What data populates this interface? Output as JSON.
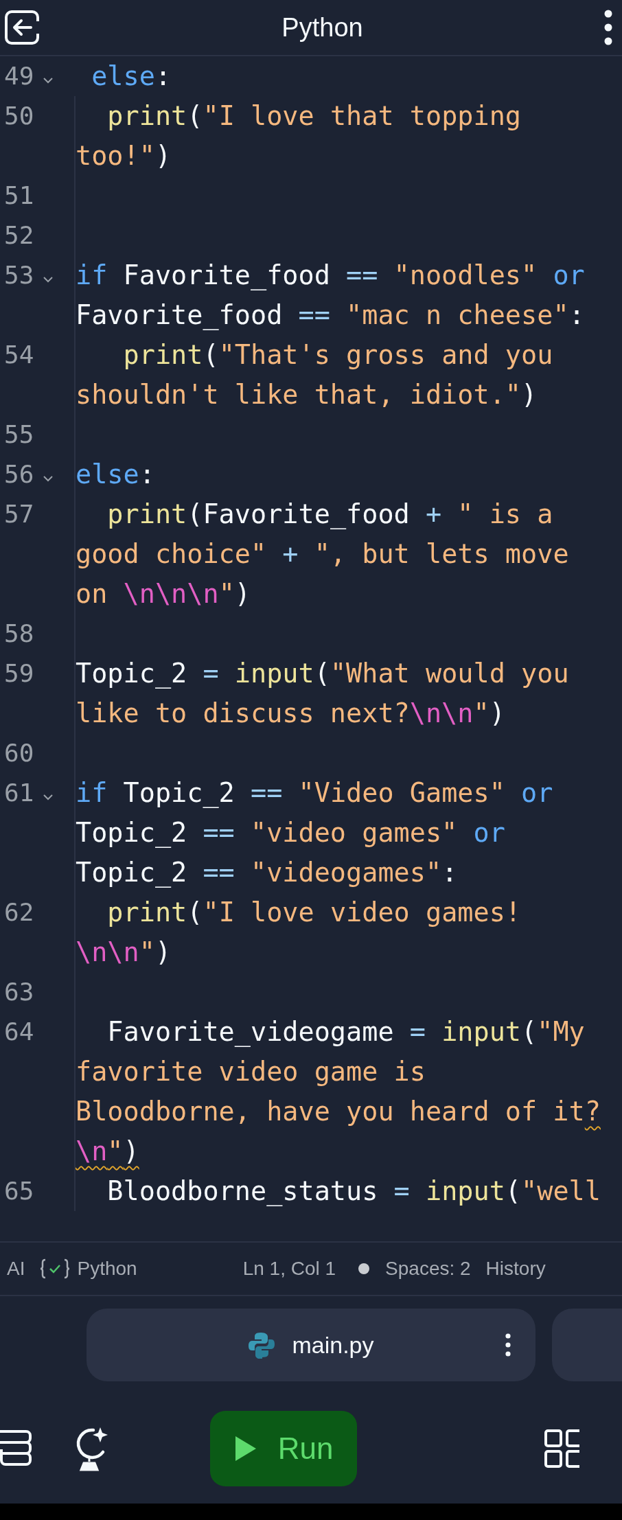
{
  "header": {
    "title": "Python"
  },
  "code": {
    "lines": [
      {
        "number": "49",
        "fold": true,
        "tokens": [
          {
            "kind": "keyword",
            "text": " else"
          },
          {
            "kind": "plain",
            "text": ":"
          }
        ]
      },
      {
        "number": "50",
        "fold": false,
        "tokens": [
          {
            "kind": "function",
            "text": "  print"
          },
          {
            "kind": "plain",
            "text": "("
          },
          {
            "kind": "string",
            "text": "\"I love that topping too!\""
          },
          {
            "kind": "plain",
            "text": ")"
          }
        ]
      },
      {
        "number": "51",
        "fold": false
      },
      {
        "number": "52",
        "fold": false
      },
      {
        "number": "53",
        "fold": true,
        "tokens": [
          {
            "kind": "keyword",
            "text": "if"
          },
          {
            "kind": "plain",
            "text": " Favorite_food "
          },
          {
            "kind": "operator",
            "text": "=="
          },
          {
            "kind": "string",
            "text": " \"noodles\""
          },
          {
            "kind": "keyword",
            "text": " or"
          },
          {
            "kind": "plain",
            "text": " Favorite_food "
          },
          {
            "kind": "operator",
            "text": "=="
          },
          {
            "kind": "string",
            "text": " \"mac n cheese\""
          },
          {
            "kind": "plain",
            "text": ":"
          }
        ]
      },
      {
        "number": "54",
        "fold": false,
        "tokens": [
          {
            "kind": "function",
            "text": "   print"
          },
          {
            "kind": "plain",
            "text": "("
          },
          {
            "kind": "string",
            "text": "\"That's gross and you shouldn't like that, idiot.\""
          },
          {
            "kind": "plain",
            "text": ")"
          }
        ]
      },
      {
        "number": "55",
        "fold": false
      },
      {
        "number": "56",
        "fold": true,
        "tokens": [
          {
            "kind": "keyword",
            "text": "else"
          },
          {
            "kind": "plain",
            "text": ":"
          }
        ]
      },
      {
        "number": "57",
        "fold": false,
        "tokens": [
          {
            "kind": "function",
            "text": "  print"
          },
          {
            "kind": "plain",
            "text": "(Favorite_food "
          },
          {
            "kind": "operator",
            "text": "+"
          },
          {
            "kind": "string",
            "text": " \" is a good choice\""
          },
          {
            "kind": "operator",
            "text": " +"
          },
          {
            "kind": "string",
            "text": " \", but lets move on "
          },
          {
            "kind": "escape",
            "text": "\\n\\n\\n"
          },
          {
            "kind": "string",
            "text": "\""
          },
          {
            "kind": "plain",
            "text": ")"
          }
        ]
      },
      {
        "number": "58",
        "fold": false
      },
      {
        "number": "59",
        "fold": false,
        "tokens": [
          {
            "kind": "plain",
            "text": "Topic_2 "
          },
          {
            "kind": "operator",
            "text": "="
          },
          {
            "kind": "function",
            "text": " input"
          },
          {
            "kind": "plain",
            "text": "("
          },
          {
            "kind": "string",
            "text": "\"What would you like to discuss next?"
          },
          {
            "kind": "escape",
            "text": "\\n\\n"
          },
          {
            "kind": "string",
            "text": "\""
          },
          {
            "kind": "plain",
            "text": ")"
          }
        ]
      },
      {
        "number": "60",
        "fold": false
      },
      {
        "number": "61",
        "fold": true,
        "tokens": [
          {
            "kind": "keyword",
            "text": "if"
          },
          {
            "kind": "plain",
            "text": " Topic_2 "
          },
          {
            "kind": "operator",
            "text": "=="
          },
          {
            "kind": "string",
            "text": " \"Video Games\""
          },
          {
            "kind": "keyword",
            "text": " or"
          },
          {
            "kind": "plain",
            "text": " Topic_2 "
          },
          {
            "kind": "operator",
            "text": "=="
          },
          {
            "kind": "string",
            "text": " \"video games\""
          },
          {
            "kind": "keyword",
            "text": " or"
          },
          {
            "kind": "plain",
            "text": " Topic_2 "
          },
          {
            "kind": "operator",
            "text": "=="
          },
          {
            "kind": "string",
            "text": " \"videogames\""
          },
          {
            "kind": "plain",
            "text": ":"
          }
        ]
      },
      {
        "number": "62",
        "fold": false,
        "tokens": [
          {
            "kind": "function",
            "text": "  print"
          },
          {
            "kind": "plain",
            "text": "("
          },
          {
            "kind": "string",
            "text": "\"I love video games! "
          },
          {
            "kind": "escape",
            "text": "\\n\\n"
          },
          {
            "kind": "string",
            "text": "\""
          },
          {
            "kind": "plain",
            "text": ")"
          }
        ]
      },
      {
        "number": "63",
        "fold": false
      },
      {
        "number": "64",
        "fold": false,
        "tokens": [
          {
            "kind": "plain",
            "text": "  Favorite_videogame "
          },
          {
            "kind": "operator",
            "text": "="
          },
          {
            "kind": "function",
            "text": " input"
          },
          {
            "kind": "plain",
            "text": "("
          },
          {
            "kind": "string",
            "text": "\"My favorite video game is Bloodborne, have you heard of it"
          },
          {
            "kind": "string",
            "text": "?",
            "warning": true
          },
          {
            "kind": "escape",
            "text": "\\n",
            "warning": true
          },
          {
            "kind": "string",
            "text": "\"",
            "warning": true
          },
          {
            "kind": "plain",
            "text": ")",
            "warning": true
          }
        ]
      },
      {
        "number": "65",
        "fold": false,
        "tokens": [
          {
            "kind": "plain",
            "text": "  Bloodborne_status "
          },
          {
            "kind": "operator",
            "text": "="
          },
          {
            "kind": "function",
            "text": " input"
          },
          {
            "kind": "plain",
            "text": "("
          },
          {
            "kind": "string",
            "text": "\"well"
          }
        ]
      }
    ]
  },
  "status_bar": {
    "ai": "AI",
    "language": "Python",
    "position": "Ln 1, Col 1",
    "indent": "Spaces: 2",
    "history": "History"
  },
  "file_tabs": [
    {
      "name": "main.py"
    }
  ],
  "toolbar": {
    "run_label": "Run"
  }
}
